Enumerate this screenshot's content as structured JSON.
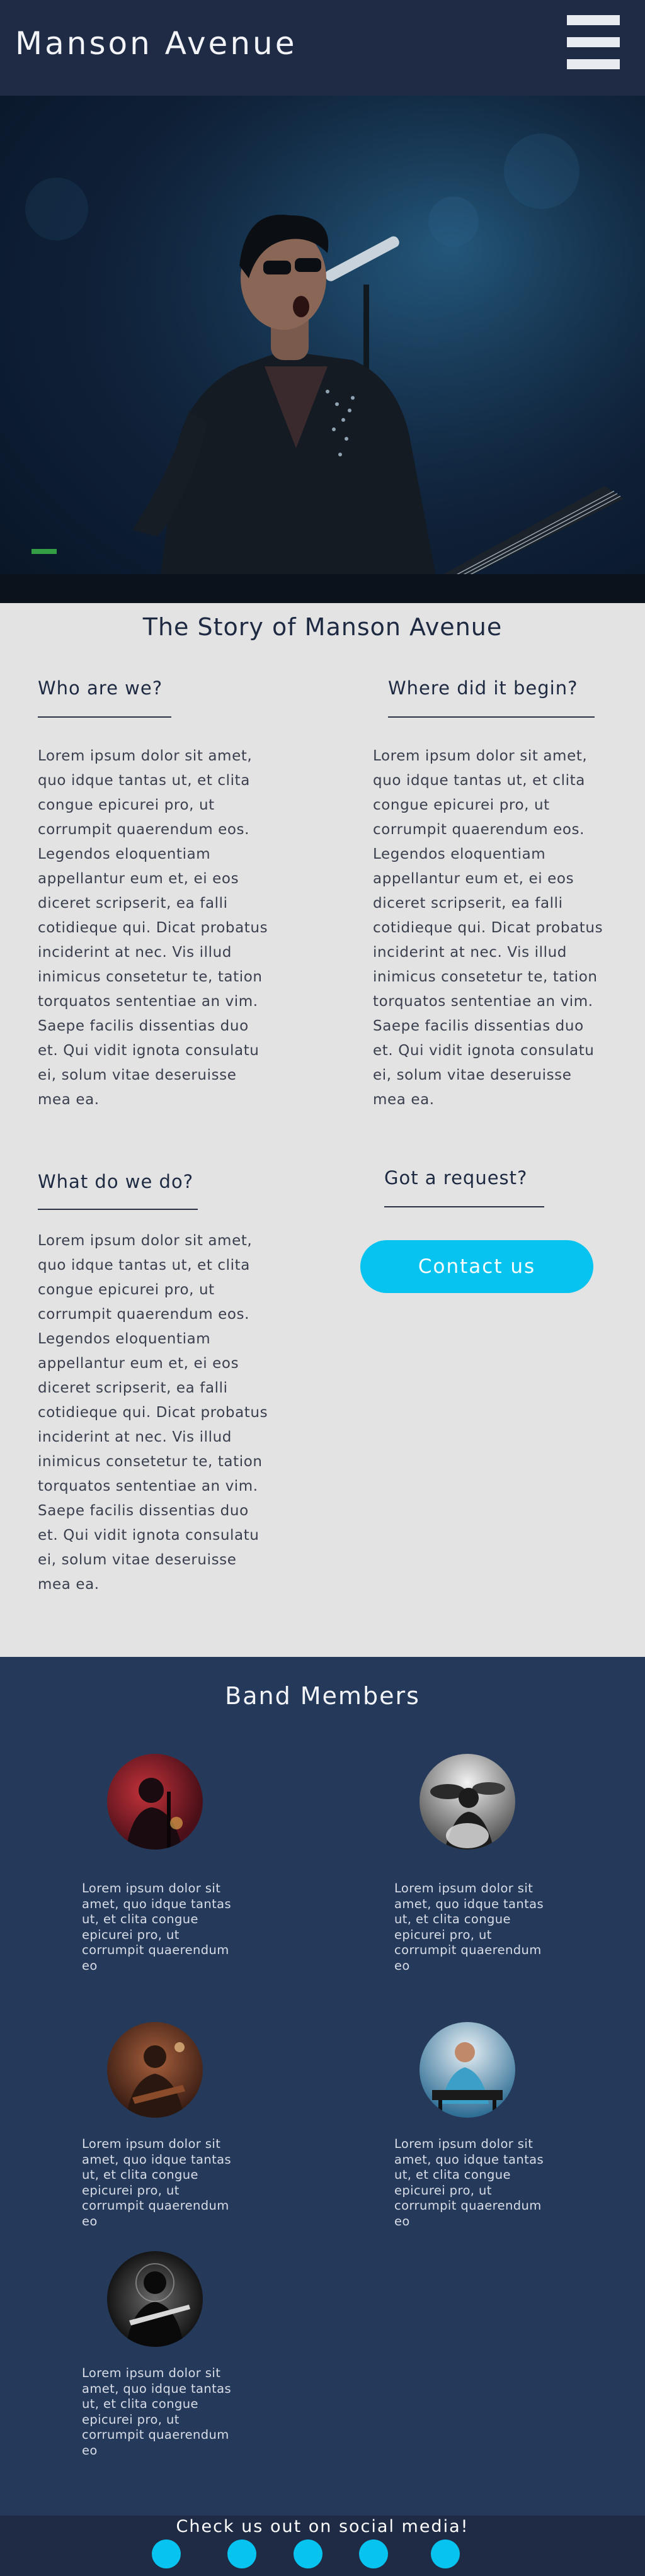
{
  "header": {
    "brand": "Manson Avenue",
    "menu_icon": "hamburger-menu-icon"
  },
  "hero": {
    "image": "singer-performing-on-stage"
  },
  "story": {
    "title": "The Story of Manson Avenue",
    "sections": [
      {
        "heading": "Who are we?",
        "body": "Lorem ipsum dolor sit amet, quo idque tantas ut, et clita congue epicurei pro, ut corrumpit quaerendum eos. Legendos eloquentiam appellantur eum et, ei eos diceret scripserit, ea falli cotidieque qui. Dicat probatus inciderint at nec. Vis illud inimicus consetetur te, tation torquatos sententiae an vim. Saepe facilis dissentias duo et. Qui vidit ignota consulatu ei, solum vitae deseruisse mea ea."
      },
      {
        "heading": "Where did it begin?",
        "body": "Lorem ipsum dolor sit amet, quo idque tantas ut, et clita congue epicurei pro, ut corrumpit quaerendum eos. Legendos eloquentiam appellantur eum et, ei eos diceret scripserit, ea falli cotidieque qui. Dicat probatus inciderint at nec. Vis illud inimicus consetetur te, tation torquatos sententiae an vim. Saepe facilis dissentias duo et. Qui vidit ignota consulatu ei, solum vitae deseruisse mea ea."
      },
      {
        "heading": "What do we do?",
        "body": "Lorem ipsum dolor sit amet, quo idque tantas ut, et clita congue epicurei pro, ut corrumpit quaerendum eos. Legendos eloquentiam appellantur eum et, ei eos diceret scripserit, ea falli cotidieque qui. Dicat probatus inciderint at nec. Vis illud inimicus consetetur te, tation torquatos sententiae an vim. Saepe facilis dissentias duo et. Qui vidit ignota consulatu ei, solum vitae deseruisse mea ea."
      },
      {
        "heading": "Got a request?"
      }
    ],
    "contact_label": "Contact us"
  },
  "band": {
    "title": "Band Members",
    "members": [
      {
        "photo": "singer-red-light-photo",
        "text": "Lorem ipsum dolor sit amet, quo idque tantas ut, et clita congue epicurei pro, ut corrumpit quaerendum eo"
      },
      {
        "photo": "drummer-black-white-photo",
        "text": "Lorem ipsum dolor sit amet, quo idque tantas ut, et clita congue epicurei pro, ut corrumpit quaerendum eo"
      },
      {
        "photo": "guitarist-warm-light-photo",
        "text": "Lorem ipsum dolor sit amet, quo idque tantas ut, et clita congue epicurei pro, ut corrumpit quaerendum eo"
      },
      {
        "photo": "keyboardist-blue-light-photo",
        "text": "Lorem ipsum dolor sit amet, quo idque tantas ut, et clita congue epicurei pro, ut corrumpit quaerendum eo"
      },
      {
        "photo": "bassist-black-white-photo",
        "text": "Lorem ipsum dolor sit amet, quo idque tantas ut, et clita congue epicurei pro, ut corrumpit quaerendum eo"
      }
    ]
  },
  "footer": {
    "text": "Check us out on social media!",
    "social_icons": [
      "social-icon-1",
      "social-icon-2",
      "social-icon-3",
      "social-icon-4",
      "social-icon-5"
    ]
  },
  "colors": {
    "header_bg": "#1f2b45",
    "band_bg": "#253a5b",
    "content_bg": "#e3e3e3",
    "accent": "#06c3ef",
    "heading_text": "#1e2942"
  }
}
